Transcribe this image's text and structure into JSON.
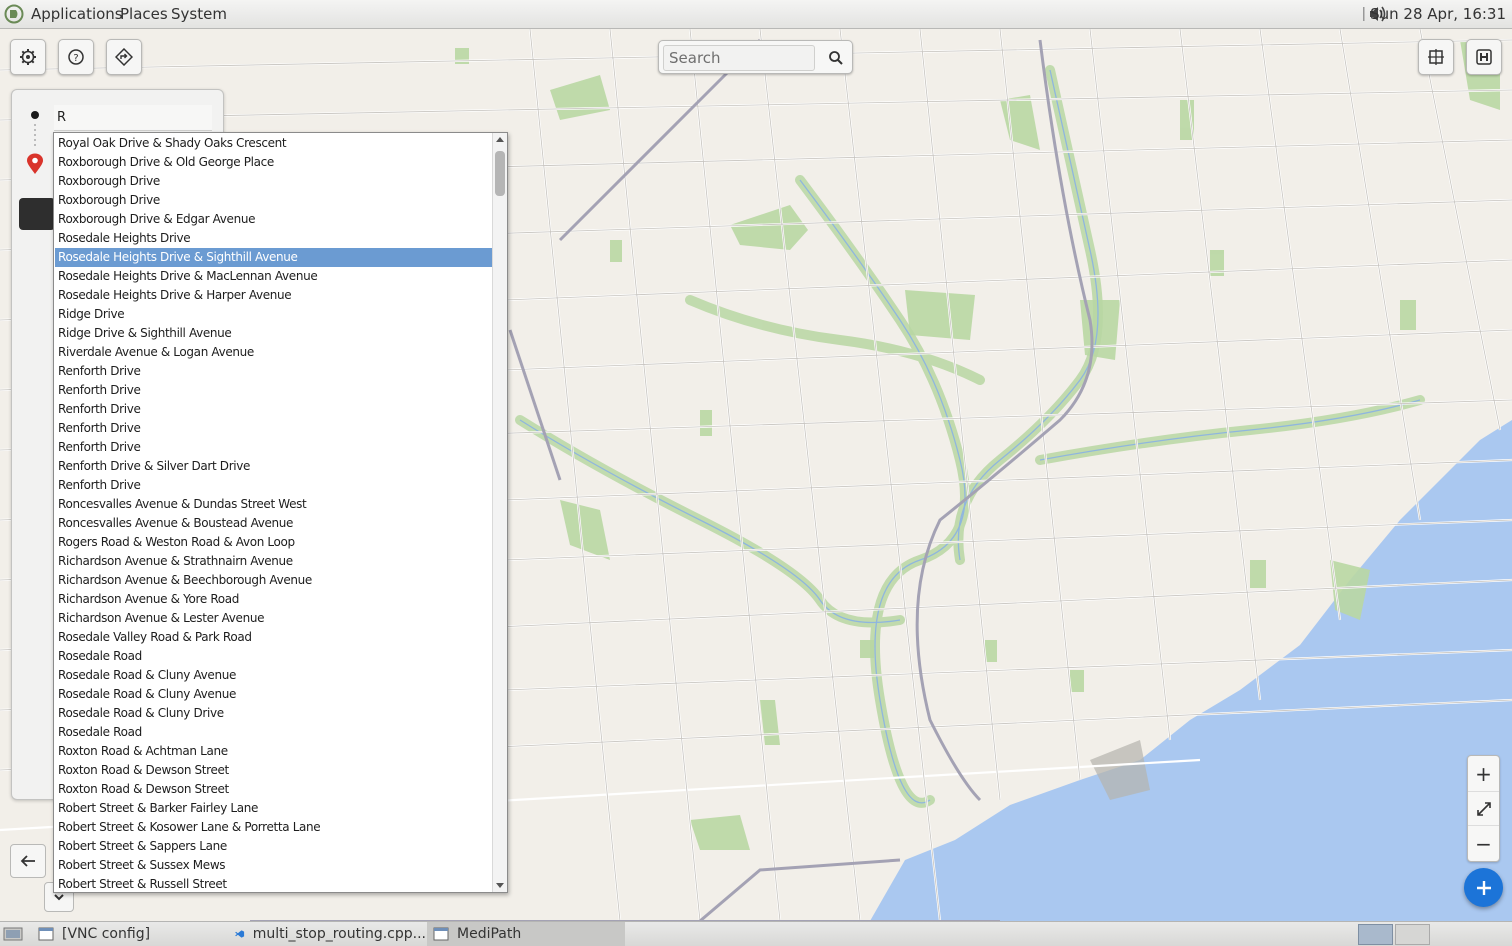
{
  "top_panel": {
    "menu": [
      "Applications",
      "Places",
      "System"
    ],
    "clock": "Sun 28 Apr, 16:31"
  },
  "toolbar": {
    "settings_icon": "gear-icon",
    "help_icon": "help-icon",
    "directions_icon": "directions-icon",
    "layers_icon": "layers-icon",
    "pois_icon": "hospital-icon"
  },
  "search": {
    "placeholder": "Search"
  },
  "route_panel": {
    "destination_value": "R"
  },
  "dropdown": {
    "selected_index": 6,
    "items": [
      "Royal Oak Drive & Shady Oaks Crescent",
      "Roxborough Drive & Old George Place",
      "Roxborough Drive",
      "Roxborough Drive",
      "Roxborough Drive & Edgar Avenue",
      "Rosedale Heights Drive",
      "Rosedale Heights Drive & Sighthill Avenue",
      "Rosedale Heights Drive & MacLennan Avenue",
      "Rosedale Heights Drive & Harper Avenue",
      "Ridge Drive",
      "Ridge Drive & Sighthill Avenue",
      "Riverdale Avenue & Logan Avenue",
      "Renforth Drive",
      "Renforth Drive",
      "Renforth Drive",
      "Renforth Drive",
      "Renforth Drive",
      "Renforth Drive & Silver Dart Drive",
      "Renforth Drive",
      "Roncesvalles Avenue & Dundas Street West",
      "Roncesvalles Avenue & Boustead Avenue",
      "Rogers Road & Weston Road & Avon Loop",
      "Richardson Avenue & Strathnairn Avenue",
      "Richardson Avenue & Beechborough Avenue",
      "Richardson Avenue & Yore Road",
      "Richardson Avenue & Lester Avenue",
      "Rosedale Valley Road & Park Road",
      "Rosedale Road",
      "Rosedale Road & Cluny Avenue",
      "Rosedale Road & Cluny Avenue",
      "Rosedale Road & Cluny Drive",
      "Rosedale Road",
      "Roxton Road & Achtman Lane",
      "Roxton Road & Dewson Street",
      "Roxton Road & Dewson Street",
      "Robert Street & Barker Fairley Lane",
      "Robert Street & Kosower Lane & Porretta Lane",
      "Robert Street & Sappers Lane",
      "Robert Street & Sussex Mews",
      "Robert Street & Russell Street"
    ]
  },
  "zoom": {
    "in_label": "+",
    "fit_icon": "expand-icon",
    "out_label": "−"
  },
  "fab": {
    "icon": "plus-icon"
  },
  "taskbar": {
    "tasks": [
      "[VNC config]",
      "multi_stop_routing.cpp...",
      "MediPath"
    ]
  },
  "colors": {
    "map_land": "#f2efe9",
    "map_water": "#aac8f0",
    "map_park": "#b9d7a3",
    "selection": "#6b9bd2",
    "fab": "#1c74d8"
  }
}
